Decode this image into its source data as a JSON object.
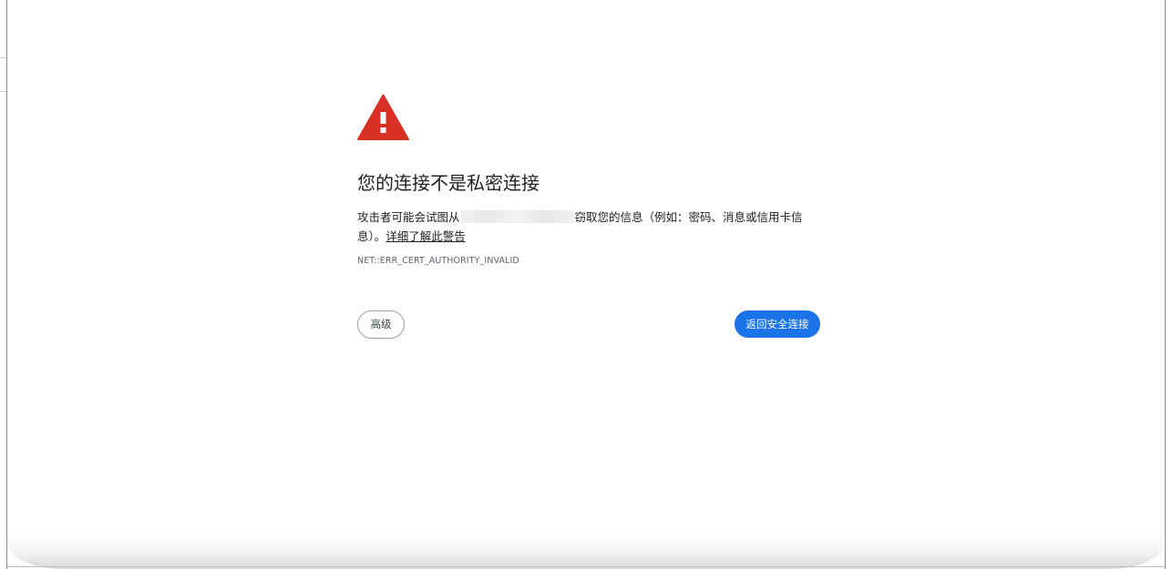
{
  "interstitial": {
    "heading": "您的连接不是私密连接",
    "message_prefix": "攻击者可能会试图从",
    "message_suffix": "窃取您的信息（例如：密码、消息或信用卡信息）。",
    "learn_more_link": "详细了解此警告",
    "error_code": "NET::ERR_CERT_AUTHORITY_INVALID",
    "advanced_button": "高级",
    "back_button": "返回安全连接",
    "icon": "warning-triangle-icon",
    "colors": {
      "warning_red": "#d93025",
      "primary_blue": "#1a73e8",
      "text": "#202124"
    }
  }
}
